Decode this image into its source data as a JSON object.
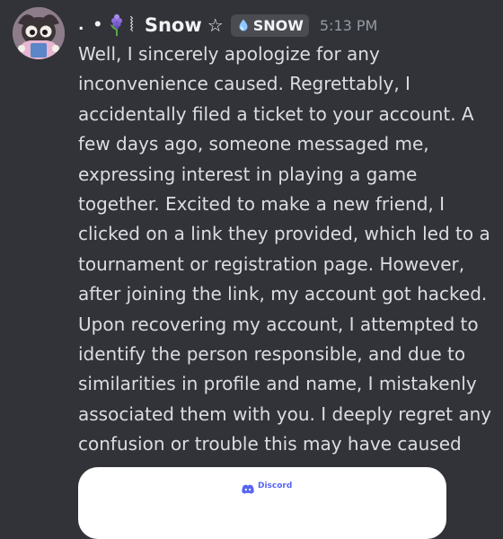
{
  "message": {
    "author": {
      "name_prefix": ". •",
      "name_brace": "⦚",
      "name": "Snow",
      "name_suffix": "☆"
    },
    "server_tag": {
      "label": "SNOW",
      "icon": "snowflake-icon"
    },
    "timestamp": "5:13 PM",
    "content": "Well, I sincerely apologize for any inconvenience caused. Regrettably, I accidentally filed a ticket to your account. A few days ago, someone messaged me, expressing interest in playing a game together. Excited to make a new friend, I clicked on a link they provided, which led to a tournament or registration page. However, after joining the link, my account got hacked. Upon recovering my account, I attempted to identify the person responsible, and due to similarities in profile and name, I mistakenly associated them with you. I deeply regret any confusion or trouble this may have caused",
    "embed": {
      "brand": "Discord"
    }
  },
  "colors": {
    "background": "#313338",
    "text": "#dbdee1",
    "timestamp": "#949ba4",
    "tag_background": "#4a4c52",
    "discord_blurple": "#5865f2"
  }
}
